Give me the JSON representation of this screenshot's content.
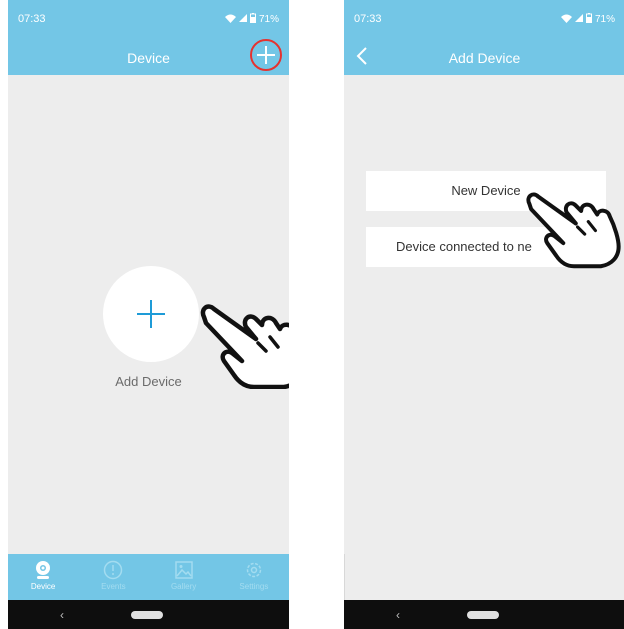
{
  "screen_left": {
    "status": {
      "time": "07:33",
      "battery": "71%"
    },
    "header": {
      "title": "Device"
    },
    "main": {
      "add_device_label": "Add Device"
    },
    "tabs": [
      {
        "label": "Device",
        "icon": "camera-icon",
        "active": true
      },
      {
        "label": "Events",
        "icon": "alert-circle-icon",
        "active": false
      },
      {
        "label": "Gallery",
        "icon": "image-icon",
        "active": false
      },
      {
        "label": "Settings",
        "icon": "gear-icon",
        "active": false
      }
    ],
    "nav": {
      "back_glyph": "‹"
    }
  },
  "screen_right": {
    "status": {
      "time": "07:33",
      "battery": "71%"
    },
    "header": {
      "title": "Add Device"
    },
    "options": [
      {
        "label": "New Device"
      },
      {
        "label": "Device connected to ne"
      }
    ],
    "nav": {
      "back_glyph": "‹"
    }
  },
  "colors": {
    "accent": "#73c6e6",
    "plus": "#1e9bd7",
    "highlight_ring": "#e5322f"
  }
}
